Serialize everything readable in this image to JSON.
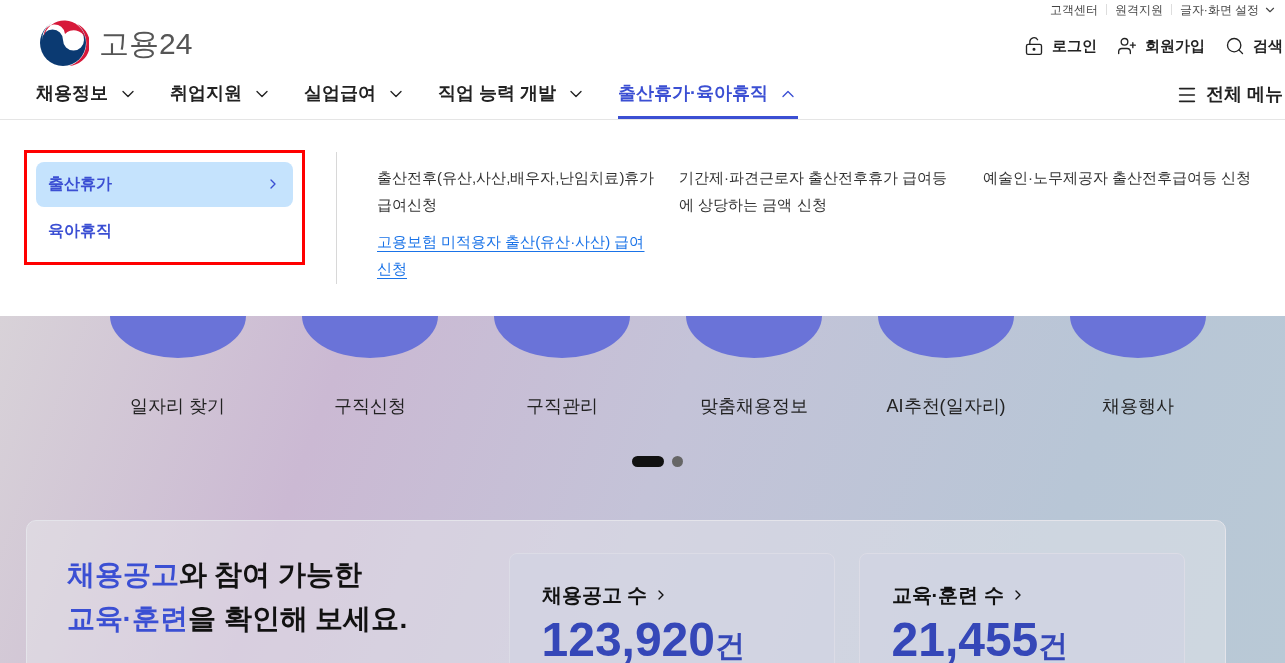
{
  "utility_links": [
    "고객센터",
    "원격지원",
    "글자·화면 설정"
  ],
  "logo": {
    "text": "고용24"
  },
  "account_links": [
    {
      "kind": "login",
      "label": "로그인"
    },
    {
      "kind": "signup",
      "label": "회원가입"
    },
    {
      "kind": "search",
      "label": "검색"
    }
  ],
  "nav": [
    {
      "label": "채용정보",
      "selected": false
    },
    {
      "label": "취업지원",
      "selected": false
    },
    {
      "label": "실업급여",
      "selected": false
    },
    {
      "label": "직업 능력 개발",
      "selected": false
    },
    {
      "label": "출산휴가·육아휴직",
      "selected": true
    }
  ],
  "all_menu": "전체 메뉴",
  "submenu": {
    "categories": [
      {
        "label": "출산휴가",
        "selected": true
      },
      {
        "label": "육아휴직",
        "selected": false
      }
    ],
    "links": [
      {
        "label": "출산전후(유산,사산,배우자,난임치료)휴가 급여신청",
        "underlined": false
      },
      {
        "label": "고용보험 미적용자 출산(유산·사산) 급여신청",
        "underlined": true
      },
      {
        "label": "기간제·파견근로자 출산전후휴가 급여등에 상당하는 금액 신청",
        "underlined": false
      },
      {
        "label": "예술인·노무제공자 출산전후급여등 신청",
        "underlined": false
      }
    ]
  },
  "quick_menu": [
    "일자리 찾기",
    "구직신청",
    "구직관리",
    "맞춤채용정보",
    "AI추천(일자리)",
    "채용행사"
  ],
  "pager": [
    {
      "selected": true
    },
    {
      "selected": false
    }
  ],
  "stats": {
    "headline": [
      [
        {
          "text": "채용공고",
          "highlight": true
        },
        {
          "text": "와 참여 가능한",
          "highlight": false
        }
      ],
      [
        {
          "text": "교육·훈련",
          "highlight": true
        },
        {
          "text": "을 확인해 보세요.",
          "highlight": false
        }
      ]
    ],
    "cards": [
      {
        "title": "채용공고 수",
        "value": "123,920",
        "unit": "건"
      },
      {
        "title": "교육·훈련 수",
        "value": "21,455",
        "unit": "건"
      }
    ]
  }
}
